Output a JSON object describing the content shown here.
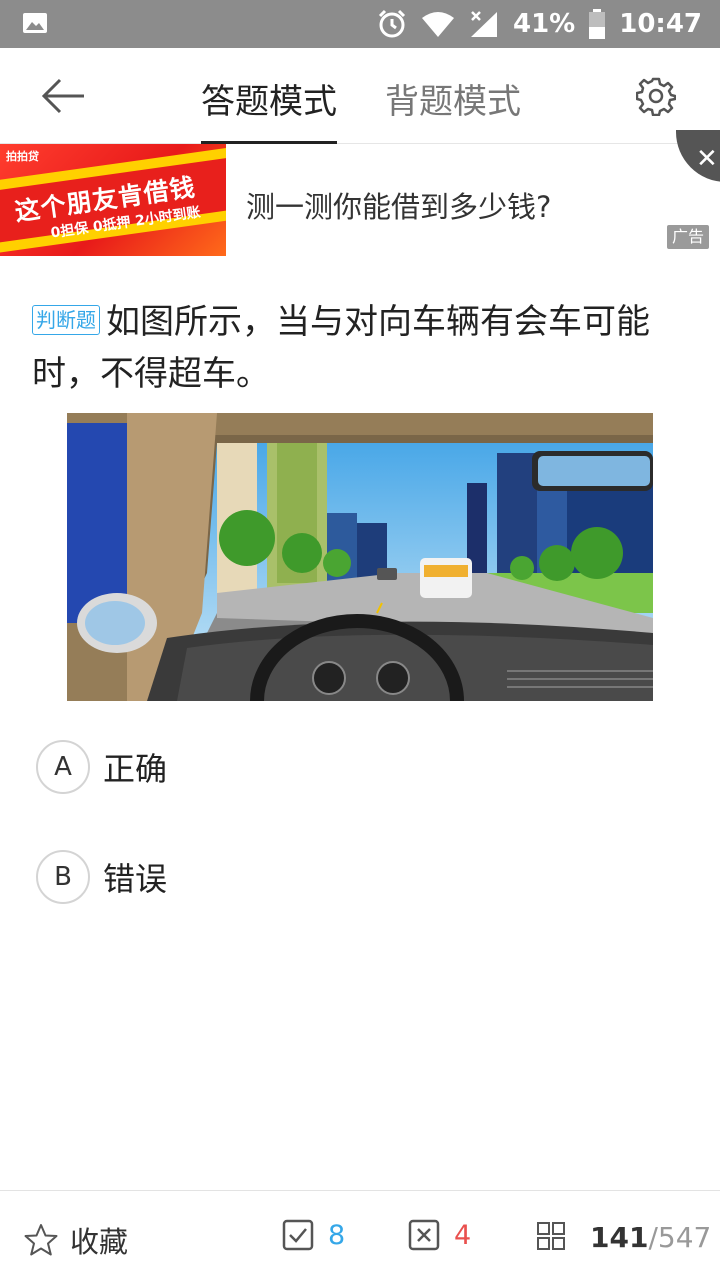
{
  "status_bar": {
    "battery": "41%",
    "time": "10:47"
  },
  "nav": {
    "tab_active": "答题模式",
    "tab_inactive": "背题模式"
  },
  "ad": {
    "banner_logo": "拍拍贷",
    "banner_headline": "这个朋友肯借钱",
    "banner_sub": "0担保 0抵押 2小时到账",
    "text": "测一测你能借到多少钱?",
    "tag": "广告",
    "close": "✕"
  },
  "question": {
    "type": "判断题",
    "text": "如图所示，当与对向车辆有会车可能时，不得超车。"
  },
  "options": [
    {
      "letter": "A",
      "text": "正确"
    },
    {
      "letter": "B",
      "text": "错误"
    }
  ],
  "bottom_bar": {
    "favorite": "收藏",
    "correct_count": "8",
    "wrong_count": "4",
    "current": "141",
    "total": "/547"
  },
  "colors": {
    "accent_blue": "#35a7e8",
    "wrong_red": "#e9504e",
    "status_bar": "#8c8c8c"
  }
}
